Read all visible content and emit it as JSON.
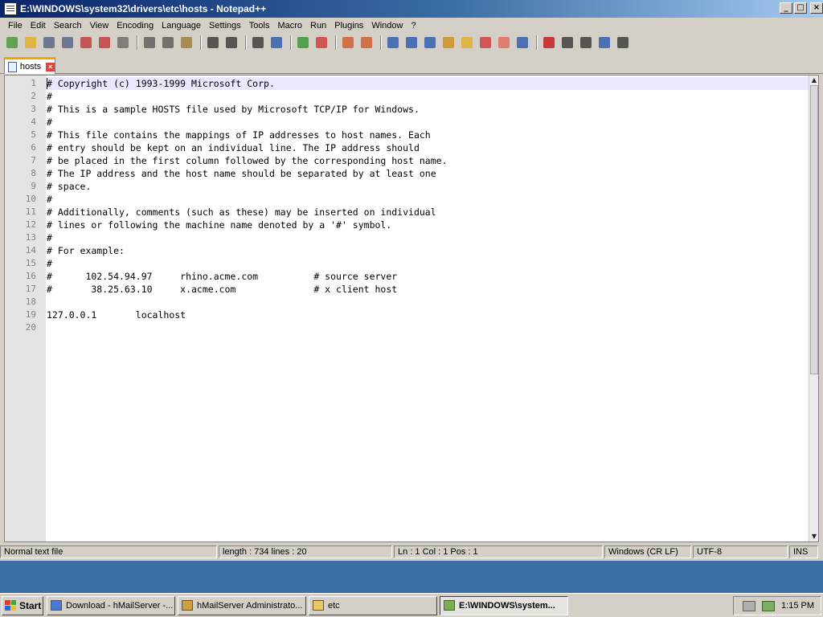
{
  "window": {
    "title": "E:\\WINDOWS\\system32\\drivers\\etc\\hosts - Notepad++",
    "minimize": "_",
    "maximize": "□",
    "close": "×"
  },
  "menu": [
    "File",
    "Edit",
    "Search",
    "View",
    "Encoding",
    "Language",
    "Settings",
    "Tools",
    "Macro",
    "Run",
    "Plugins",
    "Window",
    "?"
  ],
  "toolbar": [
    {
      "name": "new-file-icon",
      "color": "#4a9a3a"
    },
    {
      "name": "open-file-icon",
      "color": "#e0b030"
    },
    {
      "name": "save-icon",
      "color": "#5a6a8a"
    },
    {
      "name": "save-all-icon",
      "color": "#5a6a8a"
    },
    {
      "name": "close-file-icon",
      "color": "#c04040"
    },
    {
      "name": "close-all-icon",
      "color": "#c04040"
    },
    {
      "name": "print-icon",
      "color": "#707070"
    },
    "sep",
    {
      "name": "cut-icon",
      "color": "#606060"
    },
    {
      "name": "copy-icon",
      "color": "#606060"
    },
    {
      "name": "paste-icon",
      "color": "#a08040"
    },
    "sep",
    {
      "name": "undo-icon",
      "color": "#404040"
    },
    {
      "name": "redo-icon",
      "color": "#404040"
    },
    "sep",
    {
      "name": "find-icon",
      "color": "#404040"
    },
    {
      "name": "replace-icon",
      "color": "#3060b0"
    },
    "sep",
    {
      "name": "zoom-in-icon",
      "color": "#3a9a3a"
    },
    {
      "name": "zoom-out-icon",
      "color": "#d04040"
    },
    "sep",
    {
      "name": "sync-vertical-icon",
      "color": "#d06030"
    },
    {
      "name": "sync-horizontal-icon",
      "color": "#d06030"
    },
    "sep",
    {
      "name": "word-wrap-icon",
      "color": "#3060b0"
    },
    {
      "name": "show-all-chars-icon",
      "color": "#3060b0"
    },
    {
      "name": "indent-guide-icon",
      "color": "#3060b0"
    },
    {
      "name": "user-lang-icon",
      "color": "#d09020"
    },
    {
      "name": "doc-map-icon",
      "color": "#e0b030"
    },
    {
      "name": "function-list-icon",
      "color": "#d04040"
    },
    {
      "name": "folder-workspace-icon",
      "color": "#e07060"
    },
    {
      "name": "monitoring-icon",
      "color": "#3060b0"
    },
    "sep",
    {
      "name": "record-macro-icon",
      "color": "#c02020"
    },
    {
      "name": "stop-macro-icon",
      "color": "#404040"
    },
    {
      "name": "play-macro-icon",
      "color": "#404040"
    },
    {
      "name": "run-macro-multiple-icon",
      "color": "#3060b0"
    },
    {
      "name": "save-macro-icon",
      "color": "#404040"
    }
  ],
  "tab": {
    "label": "hosts",
    "close": "×"
  },
  "editor": {
    "lines": [
      {
        "num": "1",
        "text": "# Copyright (c) 1993-1999 Microsoft Corp."
      },
      {
        "num": "2",
        "text": "#"
      },
      {
        "num": "3",
        "text": "# This is a sample HOSTS file used by Microsoft TCP/IP for Windows."
      },
      {
        "num": "4",
        "text": "#"
      },
      {
        "num": "5",
        "text": "# This file contains the mappings of IP addresses to host names. Each"
      },
      {
        "num": "6",
        "text": "# entry should be kept on an individual line. The IP address should"
      },
      {
        "num": "7",
        "text": "# be placed in the first column followed by the corresponding host name."
      },
      {
        "num": "8",
        "text": "# The IP address and the host name should be separated by at least one"
      },
      {
        "num": "9",
        "text": "# space."
      },
      {
        "num": "10",
        "text": "#"
      },
      {
        "num": "11",
        "text": "# Additionally, comments (such as these) may be inserted on individual"
      },
      {
        "num": "12",
        "text": "# lines or following the machine name denoted by a '#' symbol."
      },
      {
        "num": "13",
        "text": "#"
      },
      {
        "num": "14",
        "text": "# For example:"
      },
      {
        "num": "15",
        "text": "#"
      },
      {
        "num": "16",
        "text": "#      102.54.94.97     rhino.acme.com          # source server"
      },
      {
        "num": "17",
        "text": "#       38.25.63.10     x.acme.com              # x client host"
      },
      {
        "num": "18",
        "text": ""
      },
      {
        "num": "19",
        "text": "127.0.0.1       localhost"
      },
      {
        "num": "20",
        "text": ""
      }
    ],
    "current_line": 1
  },
  "status": {
    "file_type": "Normal text file",
    "length": "length : 734    lines : 20",
    "position": "Ln : 1    Col : 1    Pos : 1",
    "eol": "Windows (CR LF)",
    "encoding": "UTF-8",
    "mode": "INS"
  },
  "taskbar": {
    "start": "Start",
    "tasks": [
      {
        "label": "Download - hMailServer -...",
        "icon": "browser-icon",
        "active": false
      },
      {
        "label": "hMailServer Administrato...",
        "icon": "hmailserver-icon",
        "active": false
      },
      {
        "label": "etc",
        "icon": "folder-icon",
        "active": false
      },
      {
        "label": "E:\\WINDOWS\\system...",
        "icon": "notepadpp-icon",
        "active": true
      }
    ],
    "clock": "1:15 PM"
  },
  "colors": {
    "title_gradient_start": "#0a246a",
    "title_gradient_end": "#a6caf0",
    "desktop": "#3a6ea5",
    "current_line": "#e8e8ff",
    "tab_accent": "#f7a300"
  }
}
